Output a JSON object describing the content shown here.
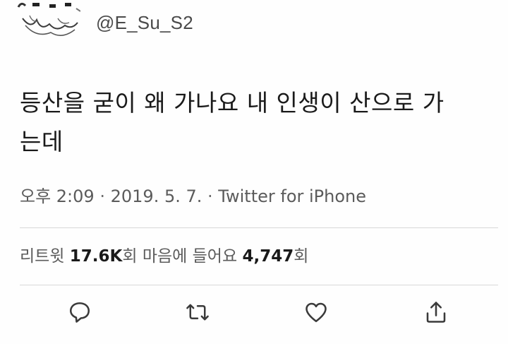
{
  "tweet": {
    "handle": "@E_Su_S2",
    "text_line1": "등산을 굳이 왜 가나요 내 인생이 산으로 가",
    "text_line2": "는데",
    "time": "오후 2:09",
    "date": "2019. 5. 7.",
    "source": "Twitter for iPhone",
    "separator": "·"
  },
  "stats": {
    "retweets_label": "리트윗",
    "retweets_count": "17.6K",
    "count_suffix": "회",
    "likes_label": "마음에 들어요",
    "likes_count": "4,747"
  },
  "actions": {
    "reply_icon": "reply-icon",
    "retweet_icon": "retweet-icon",
    "like_icon": "heart-icon",
    "share_icon": "share-icon"
  },
  "colors": {
    "text": "#1a1a1a",
    "muted": "#5b5b5b",
    "divider": "#d8d8d8",
    "icon": "#3a3a3a"
  }
}
